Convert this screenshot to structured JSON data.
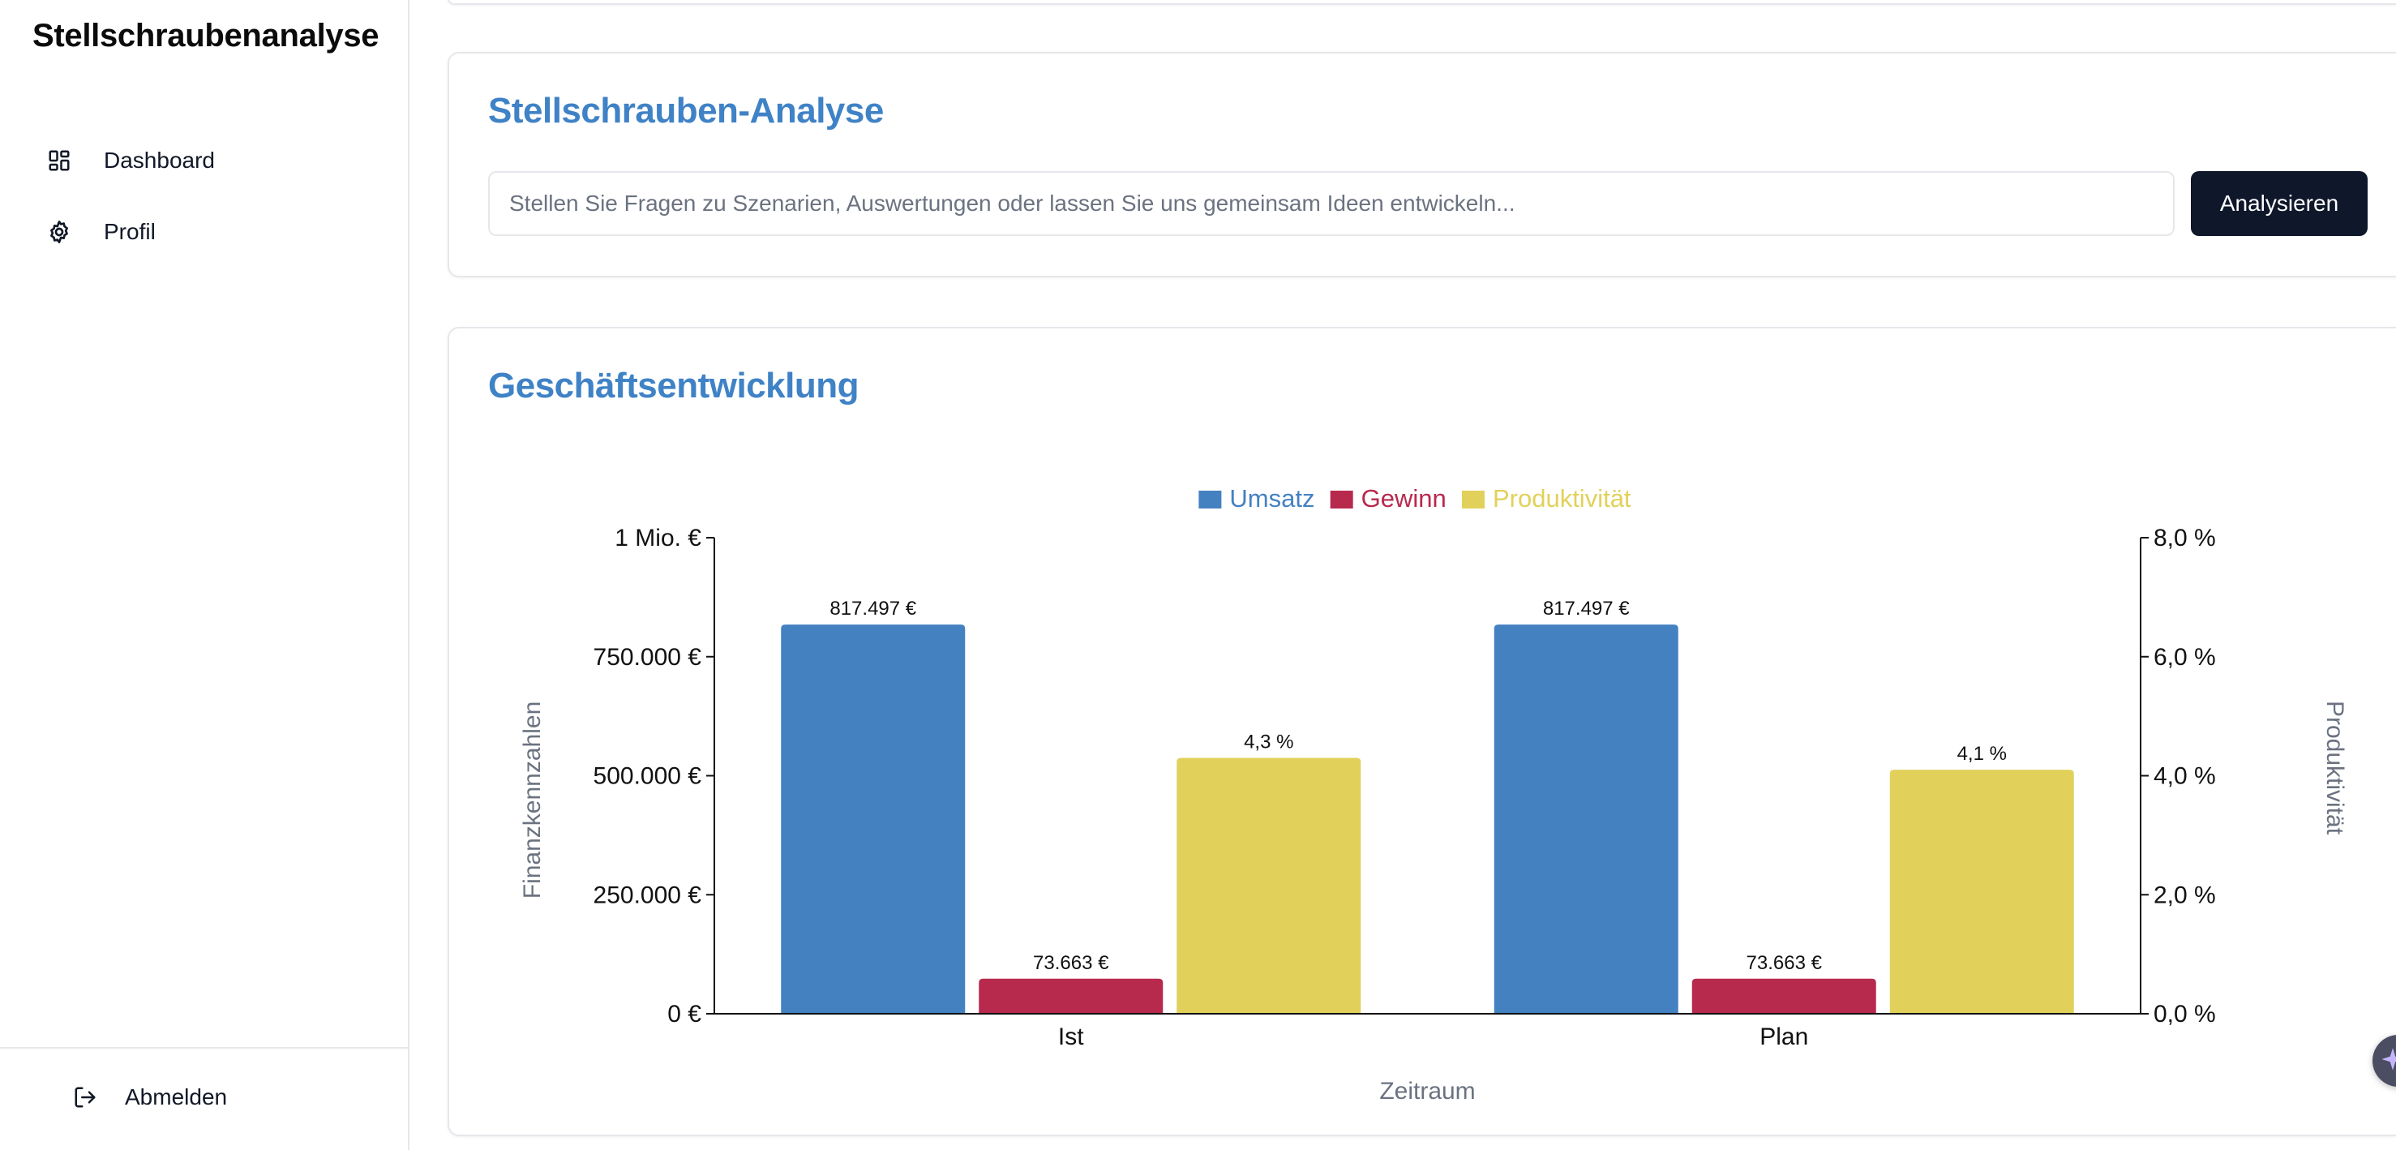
{
  "sidebar": {
    "app_title": "Stellschraubenanalyse",
    "items": [
      {
        "label": "Dashboard",
        "icon": "dashboard-grid-icon"
      },
      {
        "label": "Profil",
        "icon": "gear-icon"
      }
    ],
    "logout_label": "Abmelden"
  },
  "analysis": {
    "title": "Stellschrauben-Analyse",
    "placeholder": "Stellen Sie Fragen zu Szenarien, Auswertungen oder lassen Sie uns gemeinsam Ideen entwickeln...",
    "button_label": "Analysieren"
  },
  "business": {
    "title": "Geschäftsentwicklung"
  },
  "colors": {
    "accent": "#3f82c6",
    "umsatz": "#4381c1",
    "gewinn": "#b8294e",
    "produktivitaet": "#e1d15a",
    "button_bg": "#0f172a"
  },
  "chart_data": {
    "type": "bar",
    "categories": [
      "Ist",
      "Plan"
    ],
    "series": [
      {
        "name": "Umsatz",
        "axis": "left",
        "values": [
          817497,
          817497
        ],
        "labels": [
          "817.497 €",
          "817.497 €"
        ]
      },
      {
        "name": "Gewinn",
        "axis": "left",
        "values": [
          73663,
          73663
        ],
        "labels": [
          "73.663 €",
          "73.663 €"
        ]
      },
      {
        "name": "Produktivität",
        "axis": "right",
        "values": [
          4.3,
          4.1
        ],
        "labels": [
          "4,3 %",
          "4,1 %"
        ]
      }
    ],
    "xlabel": "Zeitraum",
    "ylabel": "Finanzkennzahlen",
    "y2label": "Produktivität",
    "ylim": [
      0,
      1000000
    ],
    "y2lim": [
      0,
      8
    ],
    "yticks": [
      "0 €",
      "250.000 €",
      "500.000 €",
      "750.000 €",
      "1 Mio. €"
    ],
    "y2ticks": [
      "0,0 %",
      "2,0 %",
      "4,0 %",
      "6,0 %",
      "8,0 %"
    ],
    "legend_position": "top-center",
    "grid": false
  }
}
